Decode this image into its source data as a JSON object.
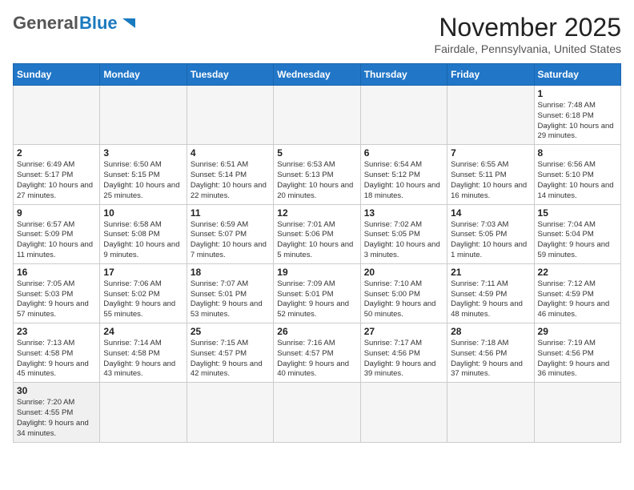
{
  "header": {
    "logo_general": "General",
    "logo_blue": "Blue",
    "title": "November 2025",
    "subtitle": "Fairdale, Pennsylvania, United States"
  },
  "days_of_week": [
    "Sunday",
    "Monday",
    "Tuesday",
    "Wednesday",
    "Thursday",
    "Friday",
    "Saturday"
  ],
  "weeks": [
    [
      {
        "day": "",
        "info": ""
      },
      {
        "day": "",
        "info": ""
      },
      {
        "day": "",
        "info": ""
      },
      {
        "day": "",
        "info": ""
      },
      {
        "day": "",
        "info": ""
      },
      {
        "day": "",
        "info": ""
      },
      {
        "day": "1",
        "info": "Sunrise: 7:48 AM\nSunset: 6:18 PM\nDaylight: 10 hours and 29 minutes."
      }
    ],
    [
      {
        "day": "2",
        "info": "Sunrise: 6:49 AM\nSunset: 5:17 PM\nDaylight: 10 hours and 27 minutes."
      },
      {
        "day": "3",
        "info": "Sunrise: 6:50 AM\nSunset: 5:15 PM\nDaylight: 10 hours and 25 minutes."
      },
      {
        "day": "4",
        "info": "Sunrise: 6:51 AM\nSunset: 5:14 PM\nDaylight: 10 hours and 22 minutes."
      },
      {
        "day": "5",
        "info": "Sunrise: 6:53 AM\nSunset: 5:13 PM\nDaylight: 10 hours and 20 minutes."
      },
      {
        "day": "6",
        "info": "Sunrise: 6:54 AM\nSunset: 5:12 PM\nDaylight: 10 hours and 18 minutes."
      },
      {
        "day": "7",
        "info": "Sunrise: 6:55 AM\nSunset: 5:11 PM\nDaylight: 10 hours and 16 minutes."
      },
      {
        "day": "8",
        "info": "Sunrise: 6:56 AM\nSunset: 5:10 PM\nDaylight: 10 hours and 14 minutes."
      }
    ],
    [
      {
        "day": "9",
        "info": "Sunrise: 6:57 AM\nSunset: 5:09 PM\nDaylight: 10 hours and 11 minutes."
      },
      {
        "day": "10",
        "info": "Sunrise: 6:58 AM\nSunset: 5:08 PM\nDaylight: 10 hours and 9 minutes."
      },
      {
        "day": "11",
        "info": "Sunrise: 6:59 AM\nSunset: 5:07 PM\nDaylight: 10 hours and 7 minutes."
      },
      {
        "day": "12",
        "info": "Sunrise: 7:01 AM\nSunset: 5:06 PM\nDaylight: 10 hours and 5 minutes."
      },
      {
        "day": "13",
        "info": "Sunrise: 7:02 AM\nSunset: 5:05 PM\nDaylight: 10 hours and 3 minutes."
      },
      {
        "day": "14",
        "info": "Sunrise: 7:03 AM\nSunset: 5:05 PM\nDaylight: 10 hours and 1 minute."
      },
      {
        "day": "15",
        "info": "Sunrise: 7:04 AM\nSunset: 5:04 PM\nDaylight: 9 hours and 59 minutes."
      }
    ],
    [
      {
        "day": "16",
        "info": "Sunrise: 7:05 AM\nSunset: 5:03 PM\nDaylight: 9 hours and 57 minutes."
      },
      {
        "day": "17",
        "info": "Sunrise: 7:06 AM\nSunset: 5:02 PM\nDaylight: 9 hours and 55 minutes."
      },
      {
        "day": "18",
        "info": "Sunrise: 7:07 AM\nSunset: 5:01 PM\nDaylight: 9 hours and 53 minutes."
      },
      {
        "day": "19",
        "info": "Sunrise: 7:09 AM\nSunset: 5:01 PM\nDaylight: 9 hours and 52 minutes."
      },
      {
        "day": "20",
        "info": "Sunrise: 7:10 AM\nSunset: 5:00 PM\nDaylight: 9 hours and 50 minutes."
      },
      {
        "day": "21",
        "info": "Sunrise: 7:11 AM\nSunset: 4:59 PM\nDaylight: 9 hours and 48 minutes."
      },
      {
        "day": "22",
        "info": "Sunrise: 7:12 AM\nSunset: 4:59 PM\nDaylight: 9 hours and 46 minutes."
      }
    ],
    [
      {
        "day": "23",
        "info": "Sunrise: 7:13 AM\nSunset: 4:58 PM\nDaylight: 9 hours and 45 minutes."
      },
      {
        "day": "24",
        "info": "Sunrise: 7:14 AM\nSunset: 4:58 PM\nDaylight: 9 hours and 43 minutes."
      },
      {
        "day": "25",
        "info": "Sunrise: 7:15 AM\nSunset: 4:57 PM\nDaylight: 9 hours and 42 minutes."
      },
      {
        "day": "26",
        "info": "Sunrise: 7:16 AM\nSunset: 4:57 PM\nDaylight: 9 hours and 40 minutes."
      },
      {
        "day": "27",
        "info": "Sunrise: 7:17 AM\nSunset: 4:56 PM\nDaylight: 9 hours and 39 minutes."
      },
      {
        "day": "28",
        "info": "Sunrise: 7:18 AM\nSunset: 4:56 PM\nDaylight: 9 hours and 37 minutes."
      },
      {
        "day": "29",
        "info": "Sunrise: 7:19 AM\nSunset: 4:56 PM\nDaylight: 9 hours and 36 minutes."
      }
    ],
    [
      {
        "day": "30",
        "info": "Sunrise: 7:20 AM\nSunset: 4:55 PM\nDaylight: 9 hours and 34 minutes."
      },
      {
        "day": "",
        "info": ""
      },
      {
        "day": "",
        "info": ""
      },
      {
        "day": "",
        "info": ""
      },
      {
        "day": "",
        "info": ""
      },
      {
        "day": "",
        "info": ""
      },
      {
        "day": "",
        "info": ""
      }
    ]
  ]
}
